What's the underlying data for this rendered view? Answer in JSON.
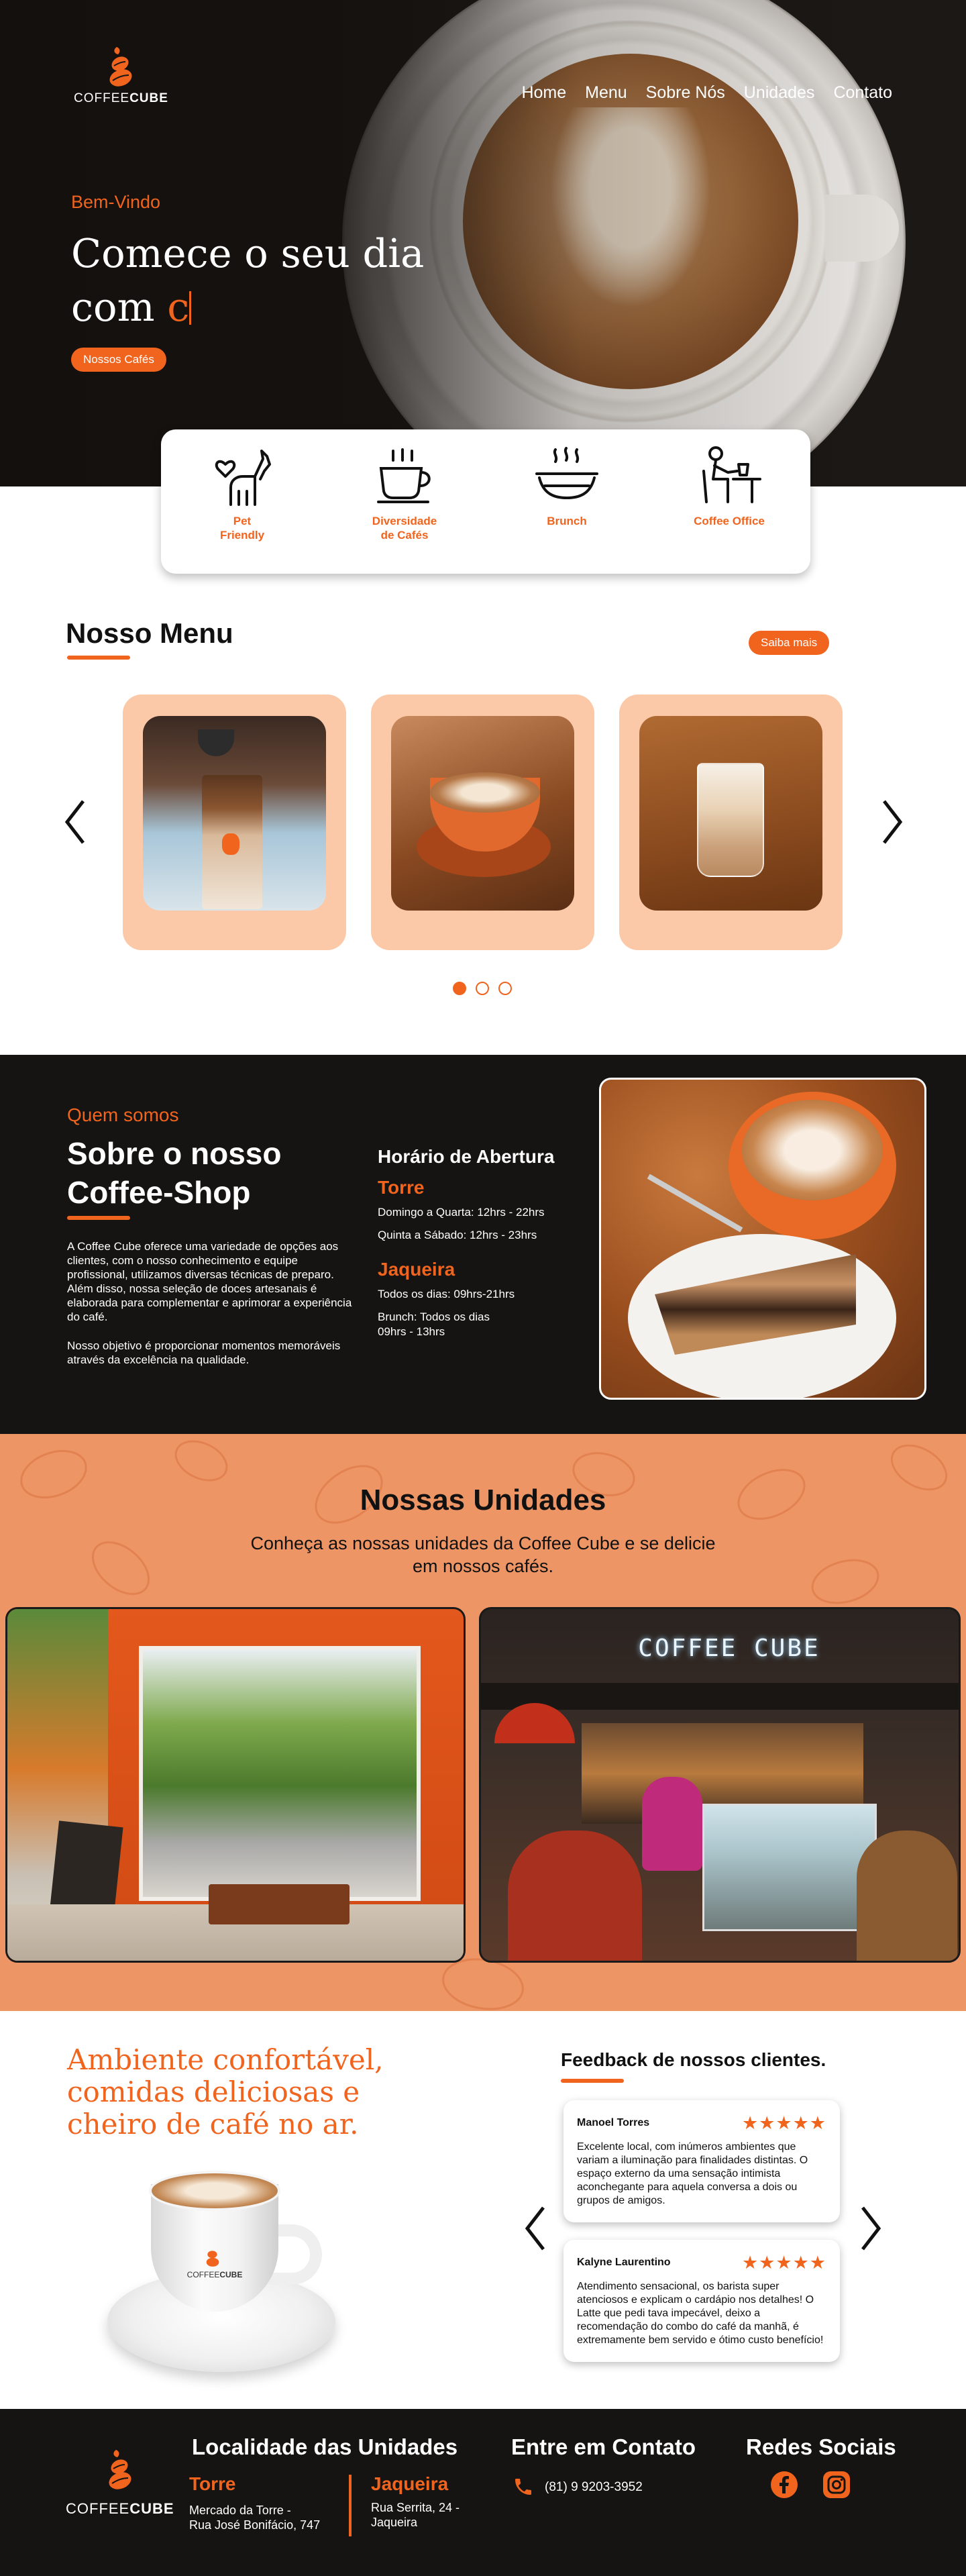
{
  "brand": {
    "word_light": "COFFEE",
    "word_bold": "CUBE",
    "accent": "#f0641e"
  },
  "nav": {
    "items": [
      "Home",
      "Menu",
      "Sobre Nós",
      "Unidades",
      "Contato"
    ]
  },
  "hero": {
    "eyebrow": "Bem-Vindo",
    "title_line1": "Comece o seu dia",
    "title_line2": "com",
    "caret": "c",
    "cta": "Nossos Cafés"
  },
  "features": [
    {
      "label_1": "Pet",
      "label_2": "Friendly",
      "icon": "pet-icon"
    },
    {
      "label_1": "Diversidade",
      "label_2": "de Cafés",
      "icon": "coffee-cup-icon"
    },
    {
      "label_1": "Brunch",
      "label_2": "",
      "icon": "brunch-plate-icon"
    },
    {
      "label_1": "Coffee Office",
      "label_2": "",
      "icon": "coffee-office-icon"
    }
  ],
  "menu": {
    "title": "Nosso Menu",
    "more": "Saiba mais"
  },
  "about": {
    "eyebrow": "Quem somos",
    "title_line1": "Sobre o nosso",
    "title_line2": "Coffee-Shop",
    "paragraph1": "A Coffee Cube oferece uma variedade de opções aos clientes, com o nosso conhecimento e equipe profissional, utilizamos diversas técnicas de preparo. Além disso, nossa seleção de doces artesanais é elaborada para complementar e aprimorar a experiência do café.",
    "paragraph2": "Nosso objetivo é proporcionar momentos memoráveis através da excelência na qualidade.",
    "hours_title": "Horário de Abertura",
    "unit1_name": "Torre",
    "unit1_hours1": "Domingo a Quarta: 12hrs - 22hrs",
    "unit1_hours2": "Quinta a Sábado: 12hrs - 23hrs",
    "unit2_name": "Jaqueira",
    "unit2_hours1": "Todos os dias: 09hrs-21hrs",
    "unit2_hours2": "Brunch: Todos os dias 09hrs - 13hrs"
  },
  "units": {
    "title": "Nossas Unidades",
    "subtitle": "Conheça as nossas unidades da Coffee Cube e se delicie em nossos cafés.",
    "sign": "COFFEE CUBE"
  },
  "ambient": {
    "line1": "Ambiente confortável,",
    "line2": "comidas deliciosas e",
    "line3": "cheiro de café no ar."
  },
  "feedback": {
    "title": "Feedback de nossos clientes.",
    "reviews": [
      {
        "name": "Manoel Torres",
        "stars": "★★★★★",
        "rating": 5,
        "text": "Excelente local, com inúmeros ambientes que variam a iluminação para finalidades distintas. O espaço externo da uma sensação intimista aconchegante para aquela conversa a dois ou grupos de amigos."
      },
      {
        "name": "Kalyne Laurentino",
        "stars": "★★★★★",
        "rating": 5,
        "text": "Atendimento sensacional, os barista super atenciosos e explicam o cardápio nos detalhes! O Latte que pedi tava impecável, deixo a recomendação do combo do café da manhã, é extremamente bem servido e ótimo custo benefício!"
      }
    ]
  },
  "footer": {
    "locations_title": "Localidade das Unidades",
    "unit1_name": "Torre",
    "unit1_addr1": "Mercado da Torre -",
    "unit1_addr2": "Rua José Bonifácio, 747",
    "unit2_name": "Jaqueira",
    "unit2_addr1": "Rua Serrita, 24 -",
    "unit2_addr2": "Jaqueira",
    "contact_title": "Entre em Contato",
    "phone": "(81) 9 9203-3952",
    "social_title": "Redes Sociais"
  }
}
